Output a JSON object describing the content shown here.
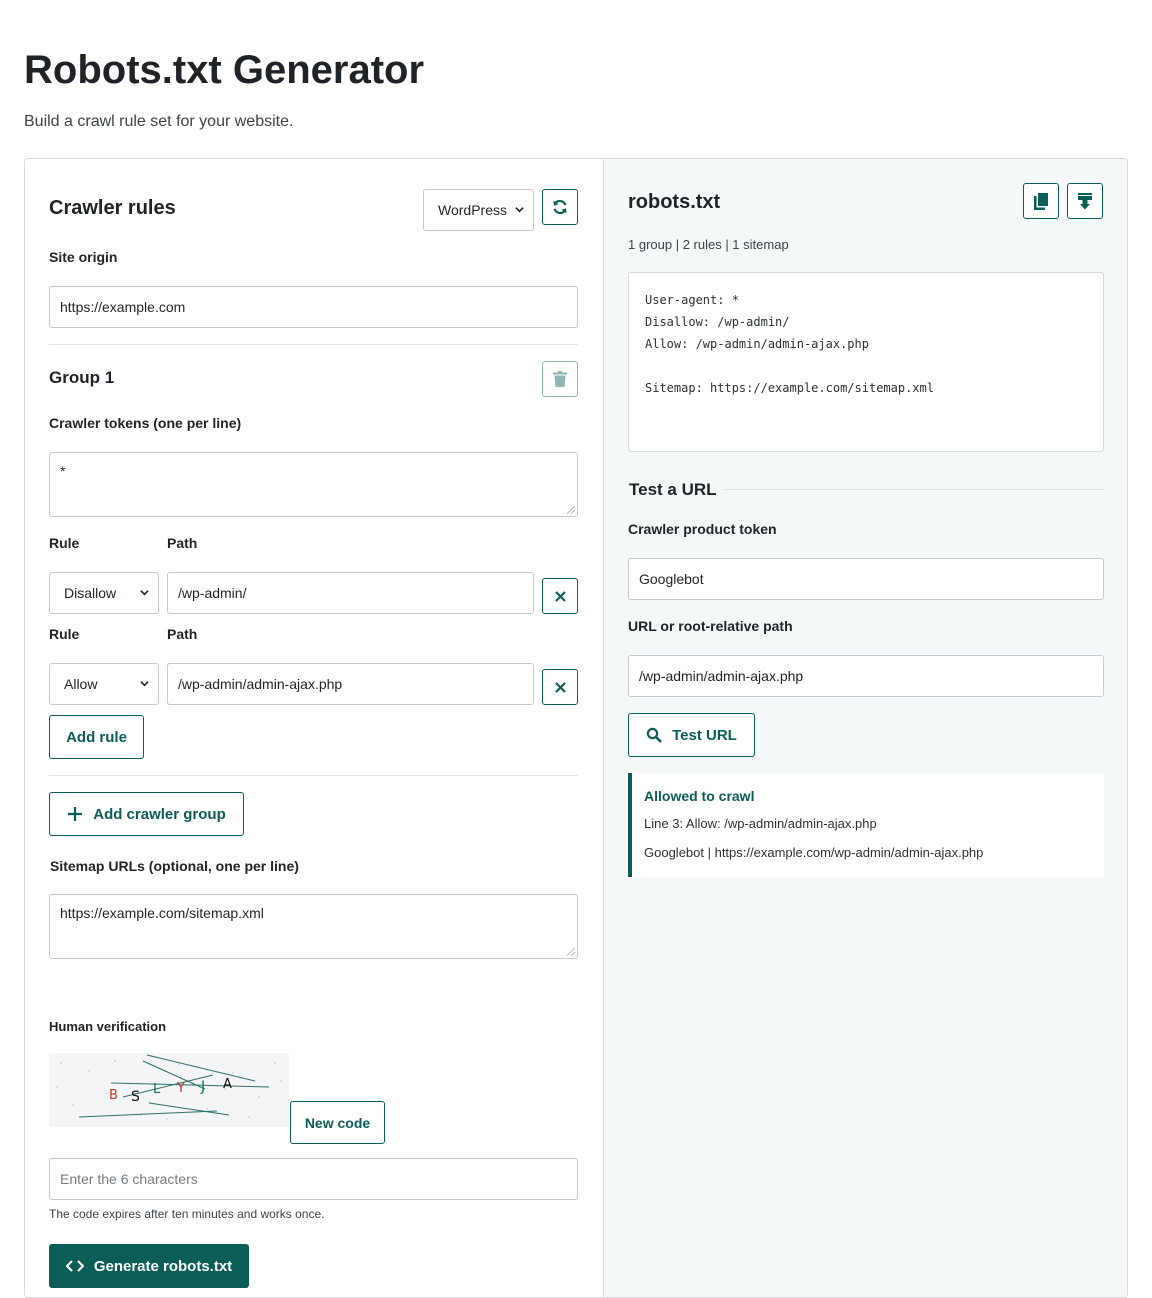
{
  "page": {
    "title": "Robots.txt Generator",
    "subtitle": "Build a crawl rule set for your website."
  },
  "left": {
    "heading": "Crawler rules",
    "preset_select": "WordPress",
    "site_origin_label": "Site origin",
    "site_origin_value": "https://example.com",
    "group": {
      "title": "Group 1",
      "tokens_label": "Crawler tokens (one per line)",
      "tokens_value": "*",
      "rules": [
        {
          "rule_label": "Rule",
          "path_label": "Path",
          "rule": "Disallow",
          "path": "/wp-admin/"
        },
        {
          "rule_label": "Rule",
          "path_label": "Path",
          "rule": "Allow",
          "path": "/wp-admin/admin-ajax.php"
        }
      ],
      "add_rule_label": "Add rule"
    },
    "add_group_label": "Add crawler group",
    "sitemap_label": "Sitemap URLs (optional, one per line)",
    "sitemap_value": "https://example.com/sitemap.xml",
    "verification": {
      "label": "Human verification",
      "captcha_chars": [
        {
          "ch": "B",
          "color": "#c0392b"
        },
        {
          "ch": "S",
          "color": "#111111"
        },
        {
          "ch": "L",
          "color": "#1f6f5a"
        },
        {
          "ch": "Y",
          "color": "#c0392b"
        },
        {
          "ch": "J",
          "color": "#1f6f5a"
        },
        {
          "ch": "A",
          "color": "#111111"
        }
      ],
      "new_code_label": "New code",
      "input_placeholder": "Enter the 6 characters",
      "hint": "The code expires after ten minutes and works once."
    },
    "generate_label": "Generate robots.txt"
  },
  "right": {
    "heading": "robots.txt",
    "stats": "1 group | 2 rules | 1 sitemap",
    "output_lines": [
      "User-agent: *",
      "Disallow: /wp-admin/",
      "Allow: /wp-admin/admin-ajax.php",
      "",
      "Sitemap: https://example.com/sitemap.xml"
    ],
    "test": {
      "heading": "Test a URL",
      "token_label": "Crawler product token",
      "token_value": "Googlebot",
      "url_label": "URL or root-relative path",
      "url_value": "/wp-admin/admin-ajax.php",
      "button_label": "Test URL",
      "result": {
        "status": "Allowed to crawl",
        "line": "Line 3: Allow: /wp-admin/admin-ajax.php",
        "detail": "Googlebot | https://example.com/wp-admin/admin-ajax.php"
      }
    }
  },
  "colors": {
    "accent": "#0b5e57",
    "panel_bg": "#f4f8f8",
    "border": "#c3c9ce"
  },
  "icons": [
    "refresh-icon",
    "trash-icon",
    "close-icon",
    "plus-icon",
    "copy-icon",
    "download-icon",
    "search-icon",
    "code-icon",
    "chevron-down-icon"
  ]
}
